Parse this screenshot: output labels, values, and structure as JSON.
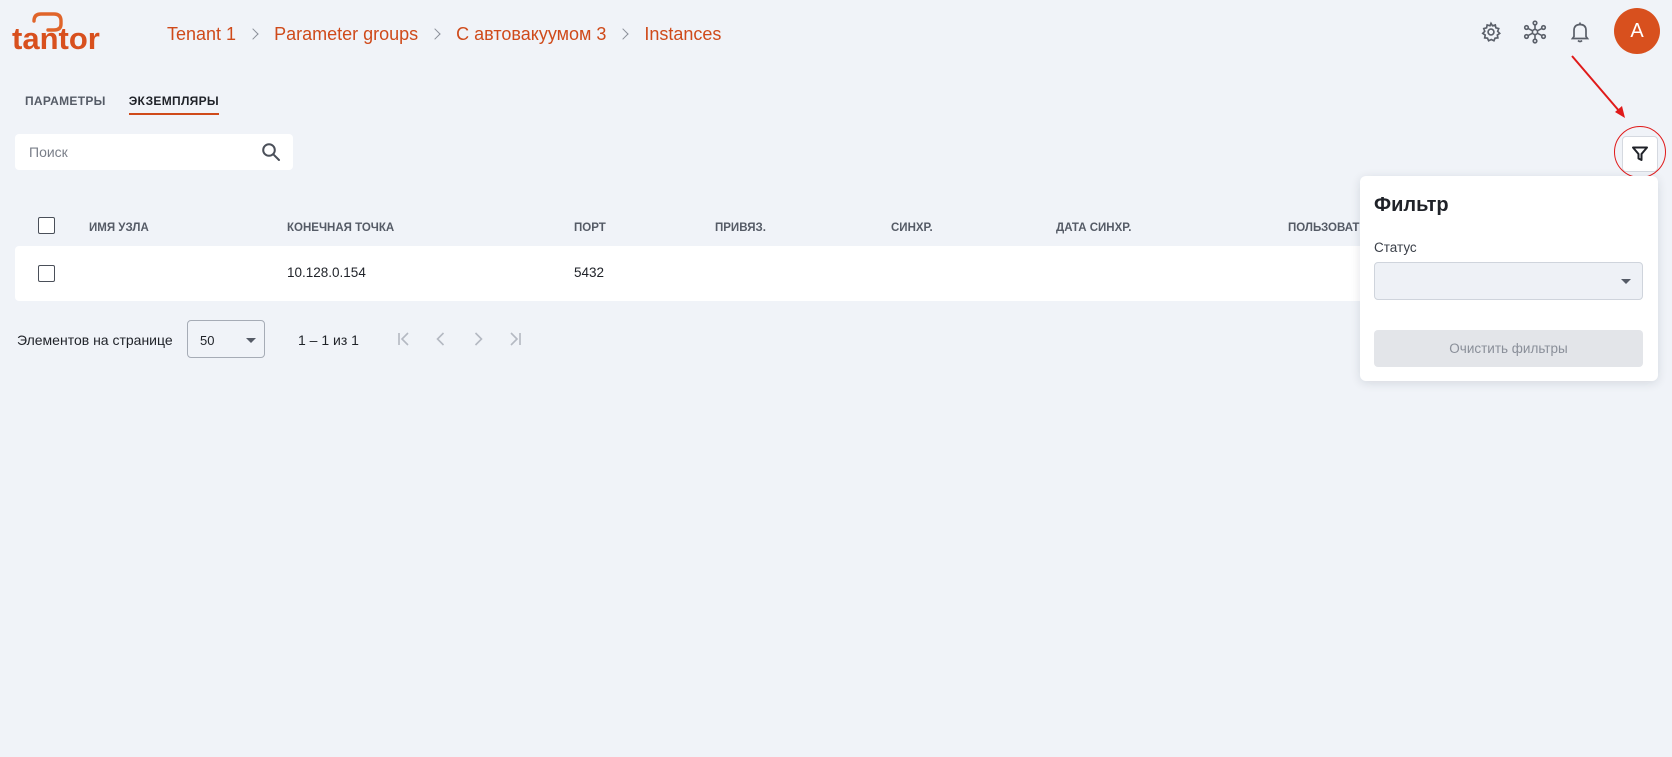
{
  "header": {
    "logo_text": "tantor",
    "breadcrumb": [
      "Tenant 1",
      "Parameter groups",
      "С автовакуумом 3",
      "Instances"
    ],
    "avatar_letter": "A",
    "icons": [
      "gear-icon",
      "cluster-icon",
      "bell-icon"
    ]
  },
  "tabs": [
    {
      "label": "ПАРАМЕТРЫ",
      "active": false
    },
    {
      "label": "ЭКЗЕМПЛЯРЫ",
      "active": true
    }
  ],
  "search": {
    "placeholder": "Поиск",
    "value": ""
  },
  "table": {
    "columns": [
      "ИМЯ УЗЛА",
      "КОНЕЧНАЯ ТОЧКА",
      "ПОРТ",
      "ПРИВЯЗ.",
      "СИНХР.",
      "ДАТА СИНХР.",
      "ПОЛЬЗОВАТЕ"
    ],
    "rows": [
      {
        "node_name": "",
        "endpoint": "10.128.0.154",
        "port": "5432",
        "bound": "",
        "sync": "",
        "sync_date": "",
        "user": ""
      }
    ]
  },
  "pagination": {
    "label": "Элементов на странице",
    "page_size": "50",
    "range": "1 – 1 из 1"
  },
  "filter_panel": {
    "title": "Фильтр",
    "status_label": "Статус",
    "status_value": "",
    "clear_label": "Очистить фильтры"
  },
  "colors": {
    "accent": "#cf4a1a",
    "avatar": "#d8501e",
    "background": "#f0f3f8",
    "annotation": "#e01a1a"
  }
}
